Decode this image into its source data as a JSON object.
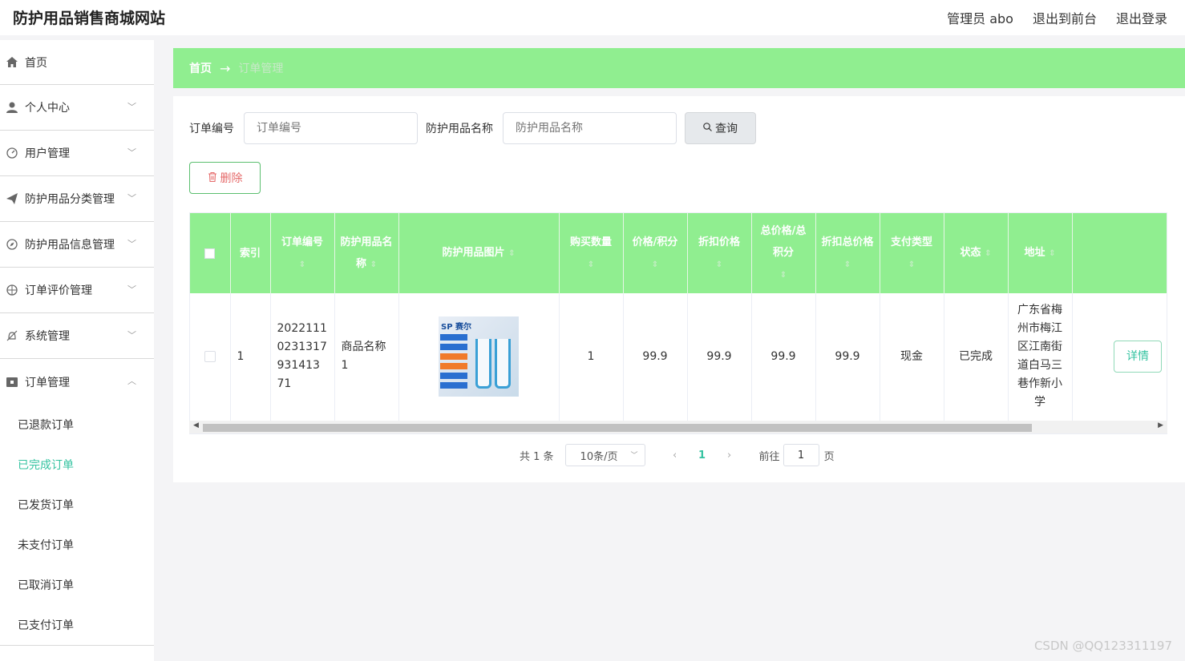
{
  "header": {
    "site_title": "防护用品销售商城网站",
    "admin_label": "管理员 abo",
    "front_link": "退出到前台",
    "logout_link": "退出登录"
  },
  "sidebar": {
    "items": [
      {
        "label": "首页",
        "icon": "home-icon"
      },
      {
        "label": "个人中心",
        "icon": "user-icon"
      },
      {
        "label": "用户管理",
        "icon": "gauge-icon"
      },
      {
        "label": "防护用品分类管理",
        "icon": "send-icon"
      },
      {
        "label": "防护用品信息管理",
        "icon": "compass-icon"
      },
      {
        "label": "订单评价管理",
        "icon": "globe-icon"
      },
      {
        "label": "系统管理",
        "icon": "no-bell-icon"
      },
      {
        "label": "订单管理",
        "icon": "order-icon"
      }
    ],
    "submenu": [
      {
        "label": "已退款订单"
      },
      {
        "label": "已完成订单"
      },
      {
        "label": "已发货订单"
      },
      {
        "label": "未支付订单"
      },
      {
        "label": "已取消订单"
      },
      {
        "label": "已支付订单"
      }
    ]
  },
  "breadcrumb": {
    "home": "首页",
    "arrow": "→",
    "current": "订单管理"
  },
  "search": {
    "order_no_label": "订单编号",
    "order_no_placeholder": "订单编号",
    "product_name_label": "防护用品名称",
    "product_name_placeholder": "防护用品名称",
    "query_button": "查询"
  },
  "toolbar": {
    "delete_button": "删除"
  },
  "table": {
    "columns": [
      "索引",
      "订单编号",
      "防护用品名称",
      "防护用品图片",
      "购买数量",
      "价格/积分",
      "折扣价格",
      "总价格/总积分",
      "折扣总价格",
      "支付类型",
      "状态",
      "地址"
    ],
    "rows": [
      {
        "index": "1",
        "order_no": "20221110231317931413 71",
        "product_name": "商品名称1",
        "image_brand": "SP 赛尔",
        "quantity": "1",
        "price": "99.9",
        "discount_price": "99.9",
        "total_price": "99.9",
        "discount_total": "99.9",
        "payment_type": "现金",
        "status": "已完成",
        "address": "广东省梅州市梅江区江南街道白马三巷作新小学",
        "detail_button": "详情"
      }
    ]
  },
  "pagination": {
    "total_text": "共 1 条",
    "page_size": "10条/页",
    "current_page": "1",
    "goto_label": "前往",
    "goto_value": "1",
    "page_suffix": "页"
  },
  "watermark": "CSDN @QQ123311197",
  "colors": {
    "accent_green": "#90ee90",
    "link_teal": "#35c3a1",
    "danger": "#e56a6a"
  }
}
